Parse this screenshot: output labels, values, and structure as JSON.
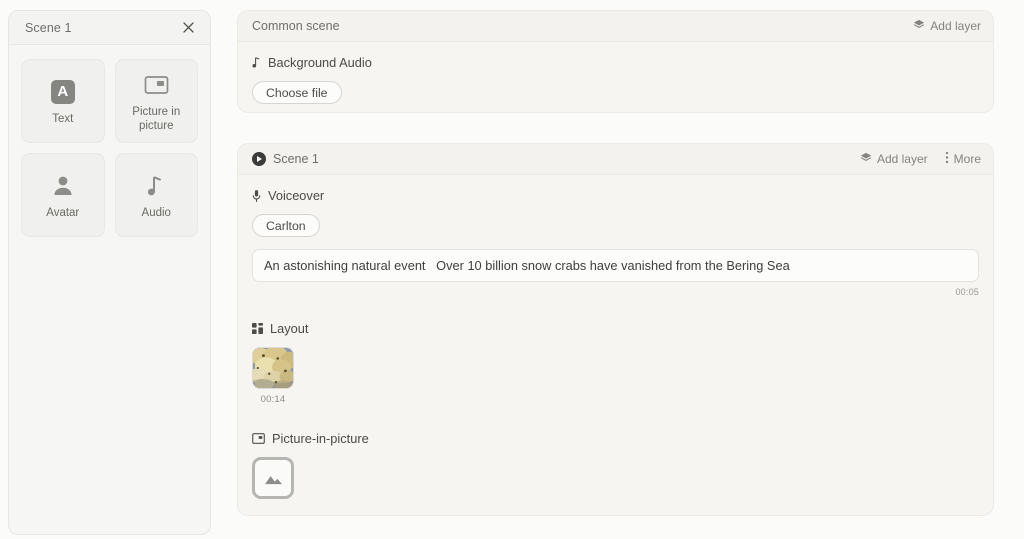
{
  "left_panel": {
    "title": "Scene 1",
    "close_icon": "close-icon",
    "blocks": [
      {
        "label": "Text",
        "icon": "text-icon"
      },
      {
        "label": "Picture in picture",
        "icon": "picture-in-picture-icon"
      },
      {
        "label": "Avatar",
        "icon": "avatar-icon"
      },
      {
        "label": "Audio",
        "icon": "audio-note-icon"
      }
    ]
  },
  "common_scene": {
    "title": "Common scene",
    "add_layer_label": "Add layer",
    "add_layer_icon": "layers-icon",
    "background_audio_label": "Background Audio",
    "background_audio_icon": "music-note-icon",
    "choose_file_label": "Choose file"
  },
  "scene": {
    "title": "Scene 1",
    "play_icon": "play-circle-icon",
    "add_layer_label": "Add layer",
    "add_layer_icon": "layers-icon",
    "more_label": "More",
    "more_icon": "more-vertical-icon",
    "voiceover": {
      "label": "Voiceover",
      "icon": "microphone-icon",
      "voice_chip": "Carlton",
      "script_text": "An astonishing natural event   Over 10 billion snow crabs have vanished from the Bering Sea",
      "duration": "00:05"
    },
    "layout": {
      "label": "Layout",
      "icon": "layout-grid-icon",
      "items": [
        {
          "name": "snow-crabs-photo",
          "duration": "00:14"
        }
      ]
    },
    "picture_in_picture": {
      "label": "Picture-in-picture",
      "icon": "picture-in-picture-icon",
      "placeholder_icon": "image-placeholder-icon"
    }
  },
  "colors": {
    "page_background": "#fbfbfa",
    "panel_background": "#f6f5f2",
    "panel_border": "#eceae5",
    "text_primary": "#3f3f3d",
    "text_muted": "#84847f",
    "accent_dark": "#3b3b39"
  }
}
